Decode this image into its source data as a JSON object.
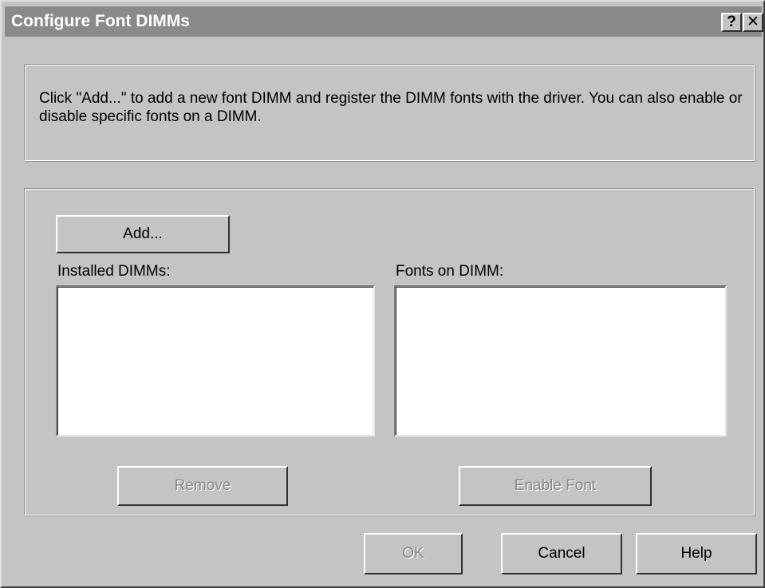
{
  "window": {
    "title": "Configure Font DIMMs",
    "help_glyph": "?",
    "close_glyph": "✕"
  },
  "instructions": "Click \"Add...\" to add a new font DIMM and register the DIMM fonts with the driver.  You can also enable or disable specific fonts on a DIMM.",
  "main": {
    "add_label": "Add...",
    "installed_label": "Installed DIMMs:",
    "fonts_label": "Fonts on DIMM:",
    "installed_items": [],
    "font_items": [],
    "remove_label": "Remove",
    "enable_font_label": "Enable Font"
  },
  "footer": {
    "ok_label": "OK",
    "cancel_label": "Cancel",
    "help_label": "Help"
  },
  "colors": {
    "face": "#c4c4c4",
    "titlebar": "#8a8a8a",
    "disabled_text": "#8a8a8a"
  }
}
